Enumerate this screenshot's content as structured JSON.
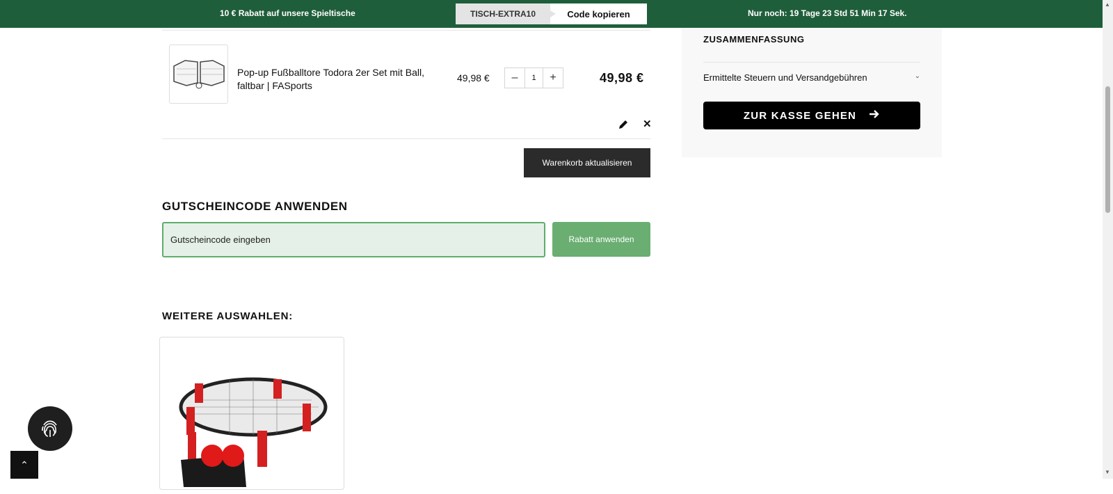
{
  "promo": {
    "left_text": "10 € Rabatt auf unsere Spieltische",
    "code": "TISCH-EXTRA10",
    "copy_label": "Code kopieren",
    "countdown": "Nur noch: 19 Tage 23 Std 51 Min 17 Sek."
  },
  "cart": {
    "item": {
      "name": "Pop-up Fußballtore Todora 2er Set mit Ball, faltbar | FASports",
      "unit_price": "49,98 €",
      "quantity": "1",
      "total": "49,98 €",
      "minus_icon": "minus-icon",
      "plus_icon": "plus-icon",
      "edit_icon": "pencil-icon",
      "remove_icon": "close-icon"
    },
    "update_label": "Warenkorb aktualisieren"
  },
  "coupon": {
    "title": "GUTSCHEINCODE ANWENDEN",
    "placeholder": "Gutscheincode eingeben",
    "apply_label": "Rabatt anwenden"
  },
  "more": {
    "title": "WEITERE AUSWAHLEN:"
  },
  "summary": {
    "title": "ZUSAMMENFASSUNG",
    "taxes_label": "Ermittelte Steuern und Versandgebühren",
    "checkout_label": "ZUR KASSE GEHEN",
    "arrow_icon": "arrow-right-icon"
  },
  "colors": {
    "promo_bg": "#1f5e3b",
    "coupon_button": "#6aae72",
    "checkout_bg": "#000000"
  }
}
